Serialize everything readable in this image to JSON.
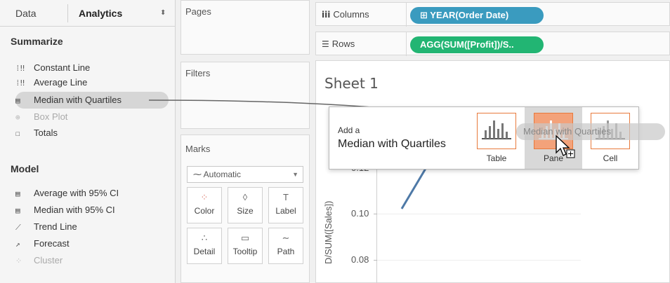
{
  "tabs": {
    "data": "Data",
    "analytics": "Analytics"
  },
  "summarize": {
    "title": "Summarize",
    "items": [
      {
        "label": "Constant Line",
        "icon": "reference-line-icon",
        "glyph": "⁞‼"
      },
      {
        "label": "Average Line",
        "icon": "reference-line-icon",
        "glyph": "⁞‼"
      },
      {
        "label": "Median with Quartiles",
        "icon": "distribution-icon",
        "glyph": "▤"
      },
      {
        "label": "Box Plot",
        "icon": "box-plot-icon",
        "glyph": "⊕"
      },
      {
        "label": "Totals",
        "icon": "totals-icon",
        "glyph": "☐"
      }
    ]
  },
  "model": {
    "title": "Model",
    "items": [
      {
        "label": "Average with 95% CI",
        "icon": "distribution-icon",
        "glyph": "▤"
      },
      {
        "label": "Median with 95% CI",
        "icon": "distribution-icon",
        "glyph": "▤"
      },
      {
        "label": "Trend Line",
        "icon": "trend-line-icon",
        "glyph": "⟋"
      },
      {
        "label": "Forecast",
        "icon": "forecast-icon",
        "glyph": "↗"
      },
      {
        "label": "Cluster",
        "icon": "cluster-icon",
        "glyph": "⁘"
      }
    ]
  },
  "cards": {
    "pages": "Pages",
    "filters": "Filters",
    "marks": "Marks"
  },
  "marks": {
    "type": "Automatic",
    "buttons": [
      {
        "label": "Color",
        "icon": "color-icon",
        "glyph": "⁘"
      },
      {
        "label": "Size",
        "icon": "size-icon",
        "glyph": "◊"
      },
      {
        "label": "Label",
        "icon": "label-icon",
        "glyph": "T"
      },
      {
        "label": "Detail",
        "icon": "detail-icon",
        "glyph": "∴"
      },
      {
        "label": "Tooltip",
        "icon": "tooltip-icon",
        "glyph": "▭"
      },
      {
        "label": "Path",
        "icon": "path-icon",
        "glyph": "∼"
      }
    ]
  },
  "shelves": {
    "columns": {
      "label": "Columns",
      "pill": "⊞ YEAR(Order Date)"
    },
    "rows": {
      "label": "Rows",
      "pill": "AGG(SUM([Profit])/S.."
    }
  },
  "sheet": {
    "title": "Sheet 1",
    "y_axis_label": "D/SUM([Sales])",
    "ticks": [
      "0.12",
      "0.10",
      "0.08"
    ]
  },
  "popup": {
    "prefix": "Add a",
    "item": "Median with Quartiles",
    "targets": [
      "Table",
      "Pane",
      "Cell"
    ]
  },
  "drag_ghost": "Median with Quartiles",
  "colors": {
    "columns_pill": "#3a9bbf",
    "rows_pill": "#22b573",
    "target_border": "#e87a3c",
    "target_active": "#f3a27a",
    "line": "#4e79a7"
  }
}
